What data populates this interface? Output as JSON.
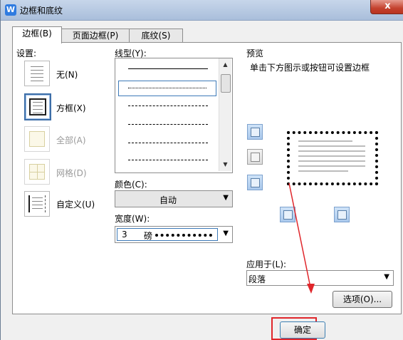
{
  "window": {
    "title": "边框和底纹",
    "close_label": "x"
  },
  "tabs": [
    {
      "label": "边框(B)"
    },
    {
      "label": "页面边框(P)"
    },
    {
      "label": "底纹(S)"
    }
  ],
  "settings": {
    "heading": "设置:",
    "items": [
      {
        "label": "无(N)",
        "enabled": true
      },
      {
        "label": "方框(X)",
        "enabled": true
      },
      {
        "label": "全部(A)",
        "enabled": false
      },
      {
        "label": "网格(D)",
        "enabled": false
      },
      {
        "label": "自定义(U)",
        "enabled": true
      }
    ]
  },
  "line_style": {
    "heading": "线型(Y):"
  },
  "color": {
    "heading": "颜色(C):",
    "value": "自动"
  },
  "width": {
    "heading": "宽度(W):",
    "value": "3",
    "unit": "磅"
  },
  "preview": {
    "heading": "预览",
    "hint": "单击下方图示或按钮可设置边框"
  },
  "apply_to": {
    "heading": "应用于(L):",
    "value": "段落"
  },
  "buttons": {
    "options": "选项(O)...",
    "ok": "确定"
  },
  "colors": {
    "annotation": "#e0262b",
    "accent": "#3d6ea8"
  }
}
